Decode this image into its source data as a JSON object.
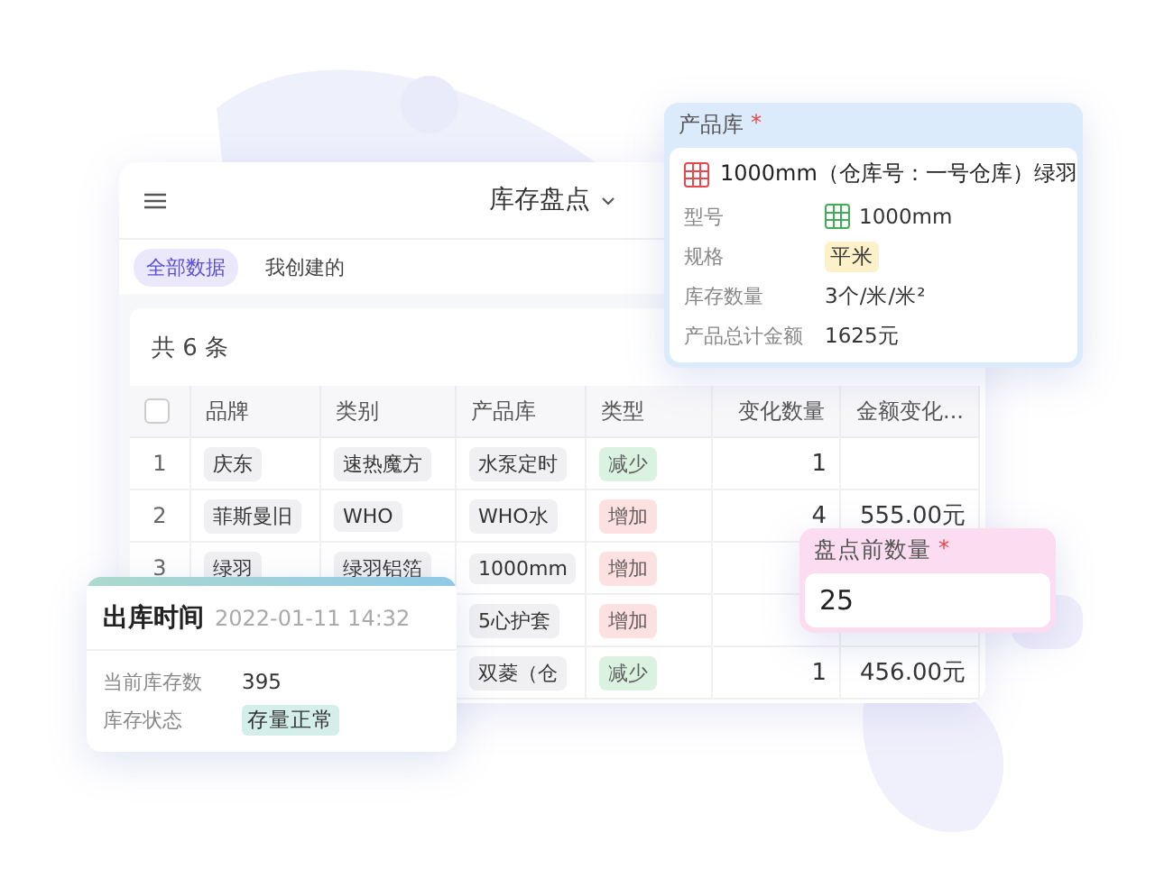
{
  "panel": {
    "title": "库存盘点"
  },
  "tabs": [
    {
      "label": "全部数据",
      "selected": true
    },
    {
      "label": "我创建的",
      "selected": false
    }
  ],
  "table": {
    "count": "共 6 条",
    "select_all": {
      "checked": false
    },
    "columns": [
      "品牌",
      "类别",
      "产品库",
      "类型",
      "变化数量",
      "金额变化..."
    ],
    "rows": [
      {
        "index": "1",
        "brand": "庆东",
        "category": "速热魔方",
        "product": "水泵定时",
        "type": {
          "label": "减少",
          "color": "#dcf2e0"
        },
        "quantity": "1"
      },
      {
        "index": "2",
        "brand": "菲斯曼旧",
        "category": "WHO",
        "product": "WHO水",
        "type": {
          "label": "增加",
          "color": "#fde0e0"
        },
        "quantity": "4",
        "amount": "555.00元"
      },
      {
        "index": "3",
        "brand": "绿羽",
        "category": "绿羽铝箔",
        "product": "1000mm",
        "type": {
          "label": "增加",
          "color": "#fde0e0"
        }
      },
      {
        "product": "5心护套",
        "type": {
          "label": "增加",
          "color": "#fde0e0"
        }
      },
      {
        "product": "双菱（仓",
        "type": {
          "label": "减少",
          "color": "#dcf2e0"
        },
        "quantity": "1",
        "amount": "456.00元"
      }
    ]
  },
  "product_card": {
    "label": "产品库",
    "required_mark": "*",
    "main": "1000mm（仓库号：一号仓库）绿羽",
    "fields": [
      {
        "kind": "icon_text",
        "label": "型号",
        "value": "1000mm"
      },
      {
        "kind": "tag",
        "label": "规格",
        "value": "平米"
      },
      {
        "kind": "text",
        "label": "库存数量",
        "value": "3个/米/米²"
      },
      {
        "kind": "text",
        "label": "产品总计金额",
        "value": "1625元"
      }
    ]
  },
  "outbound_card": {
    "title": "出库时间",
    "time": "2022-01-11 14:32",
    "fields": [
      {
        "kind": "text",
        "label": "当前库存数",
        "value": "395"
      },
      {
        "kind": "tag",
        "label": "库存状态",
        "value": "存量正常"
      }
    ]
  },
  "count_card": {
    "label": "盘点前数量",
    "required_mark": "*",
    "value": "25"
  }
}
